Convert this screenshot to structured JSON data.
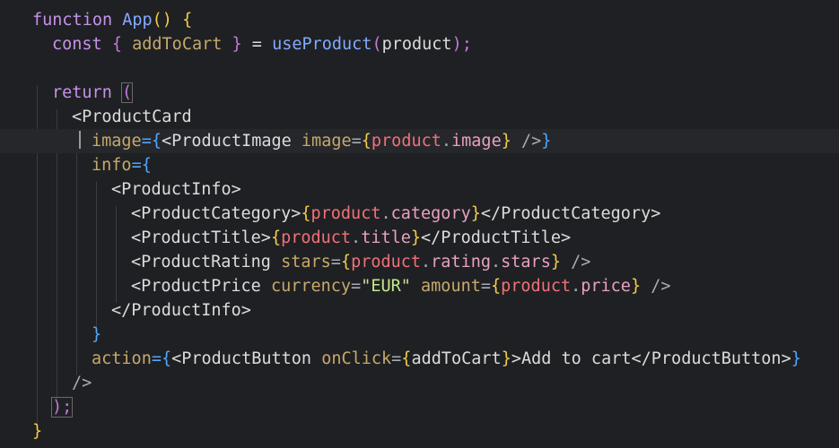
{
  "editor": {
    "background": "#1f2023",
    "language": "jsx",
    "active_line": 6
  },
  "code": {
    "kw_function": "function",
    "fn_app": "App",
    "paren_open_close": "()",
    "brace_open": "{",
    "kw_const": "const",
    "destructure_open": "{",
    "add_to_cart": "addToCart",
    "destructure_close": "}",
    "equals": "=",
    "use_product": "useProduct",
    "paren_open": "(",
    "product_arg": "product",
    "paren_close_semi": ");",
    "kw_return": "return",
    "return_paren": "(",
    "tag_product_card": "<ProductCard",
    "attr_image": "image",
    "eq_brace_open": "={",
    "tag_product_image": "<ProductImage",
    "attr_image_inner": "image",
    "eq": "=",
    "curly_open": "{",
    "product_obj": "product",
    "dot": ".",
    "prop_image": "image",
    "curly_close": "}",
    "self_close": "/>",
    "attr_info": "info",
    "tag_product_info_open": "<ProductInfo>",
    "tag_product_category_open": "<ProductCategory>",
    "prop_category": "category",
    "tag_product_category_close": "</ProductCategory>",
    "tag_product_title_open": "<ProductTitle>",
    "prop_title": "title",
    "tag_product_title_close": "</ProductTitle>",
    "tag_product_rating": "<ProductRating",
    "attr_stars": "stars",
    "prop_rating": "rating",
    "prop_stars": "stars",
    "tag_product_price": "<ProductPrice",
    "attr_currency": "currency",
    "str_eur": "\"EUR\"",
    "attr_amount": "amount",
    "prop_price": "price",
    "tag_product_info_close": "</ProductInfo>",
    "attr_action": "action",
    "tag_product_button": "<ProductButton",
    "attr_onclick": "onClick",
    "gt": ">",
    "button_text": "Add to cart",
    "tag_product_button_close": "</ProductButton>",
    "semicolon": ";"
  }
}
